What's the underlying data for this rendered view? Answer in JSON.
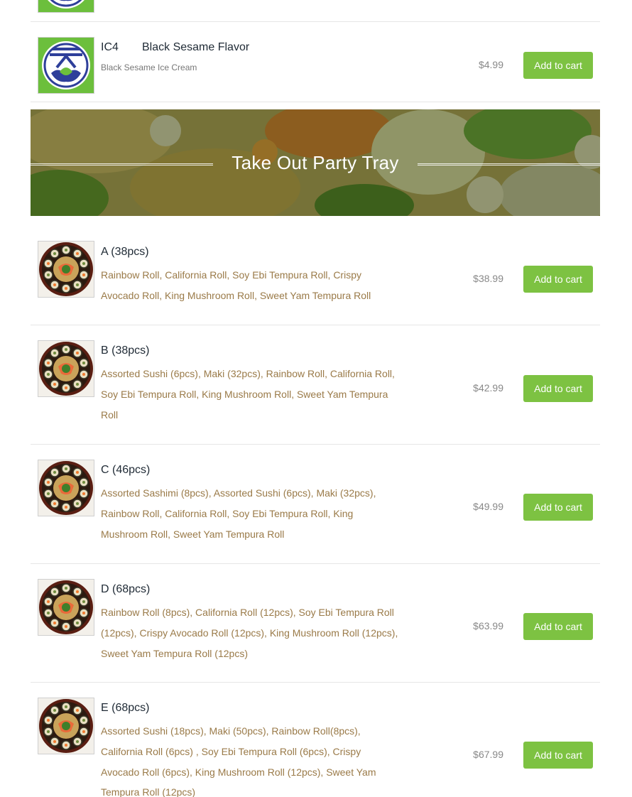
{
  "ice_cream": {
    "items": [
      {
        "code": "IC4",
        "name": "Black Sesame Flavor",
        "subtitle": "Black Sesame Ice Cream",
        "price": "$4.99",
        "button": "Add to cart",
        "image_icon": "restaurant-logo-icon"
      }
    ]
  },
  "banner": {
    "title": "Take Out Party Tray"
  },
  "party_tray": {
    "items": [
      {
        "name": "A (38pcs)",
        "description": "Rainbow Roll, California Roll, Soy Ebi Tempura Roll, Crispy Avocado Roll, King Mushroom Roll, Sweet Yam Tempura Roll",
        "price": "$38.99",
        "button": "Add to cart"
      },
      {
        "name": "B (38pcs)",
        "description": "Assorted Sushi (6pcs), Maki (32pcs), Rainbow Roll, California Roll, Soy Ebi Tempura Roll, King Mushroom Roll, Sweet Yam Tempura Roll",
        "price": "$42.99",
        "button": "Add to cart"
      },
      {
        "name": "C (46pcs)",
        "description": "Assorted Sashimi (8pcs), Assorted Sushi (6pcs), Maki (32pcs), Rainbow Roll, California Roll, Soy Ebi Tempura Roll, King Mushroom Roll, Sweet Yam Tempura Roll",
        "price": "$49.99",
        "button": "Add to cart"
      },
      {
        "name": "D (68pcs)",
        "description": "Rainbow Roll (8pcs), California Roll (12pcs), Soy Ebi Tempura Roll (12pcs), Crispy Avocado Roll (12pcs), King Mushroom Roll (12pcs), Sweet Yam Tempura Roll (12pcs)",
        "price": "$63.99",
        "button": "Add to cart"
      },
      {
        "name": "E (68pcs)",
        "description": "Assorted Sushi (18pcs), Maki (50pcs), Rainbow Roll(8pcs), California Roll (6pcs) , Soy Ebi Tempura Roll (6pcs), Crispy Avocado Roll (6pcs), King Mushroom Roll (12pcs), Sweet Yam Tempura Roll (12pcs)",
        "price": "$67.99",
        "button": "Add to cart"
      }
    ]
  },
  "colors": {
    "button_bg": "#7dc242",
    "description_text": "#9a7a48",
    "logo_blue": "#2e3f9a",
    "logo_green": "#6cbf3c"
  }
}
